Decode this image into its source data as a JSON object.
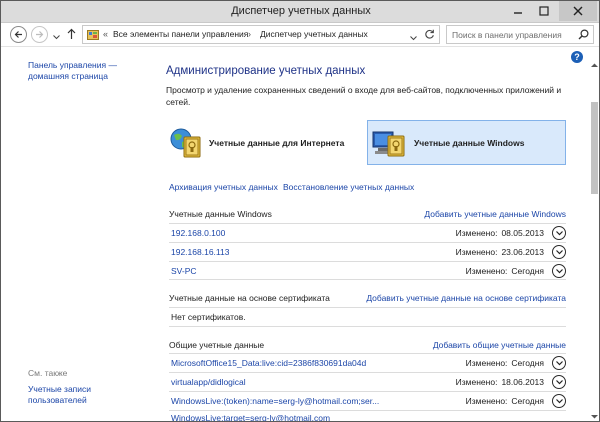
{
  "window": {
    "title": "Диспетчер учетных данных"
  },
  "address": {
    "chevrons": "«",
    "crumb1": "Все элементы панели управления",
    "arrow": "›",
    "crumb2": "Диспетчер учетных данных",
    "search_placeholder": "Поиск в панели управления"
  },
  "left_pane": {
    "home_line1": "Панель управления —",
    "home_line2": "домашняя страница",
    "see_also": "См. также",
    "user_accounts_line1": "Учетные записи",
    "user_accounts_line2": "пользователей"
  },
  "main": {
    "heading": "Администрирование учетных данных",
    "description": "Просмотр и удаление сохраненных сведений о входе для веб-сайтов, подключенных приложений и сетей.",
    "tile_web": "Учетные данные для Интернета",
    "tile_windows": "Учетные данные Windows",
    "backup_link": "Архивация учетных данных",
    "restore_link": "Восстановление учетных данных",
    "changed_label": "Изменено:",
    "windows_creds": {
      "title": "Учетные данные Windows",
      "add": "Добавить учетные данные Windows",
      "rows": [
        {
          "name": "192.168.0.100",
          "date": "08.05.2013"
        },
        {
          "name": "192.168.16.113",
          "date": "23.06.2013"
        },
        {
          "name": "SV-PC",
          "date": "Сегодня"
        }
      ]
    },
    "cert_creds": {
      "title": "Учетные данные на основе сертификата",
      "add": "Добавить учетные данные на основе сертификата",
      "empty": "Нет сертификатов."
    },
    "generic_creds": {
      "title": "Общие учетные данные",
      "add": "Добавить общие учетные данные",
      "rows": [
        {
          "name": "MicrosoftOffice15_Data:live:cid=2386f830691da04d",
          "date": "Сегодня"
        },
        {
          "name": "virtualapp/didlogical",
          "date": "18.06.2013"
        },
        {
          "name": "WindowsLive:(token):name=serg-ly@hotmail.com;ser...",
          "date": "Сегодня"
        },
        {
          "name": "WindowsLive:target=serg-ly@hotmail.com",
          "date": ""
        }
      ]
    }
  },
  "colors": {
    "link": "#1c46a8",
    "heading": "#1e3287",
    "selected_tile": "#d9e9fb"
  }
}
